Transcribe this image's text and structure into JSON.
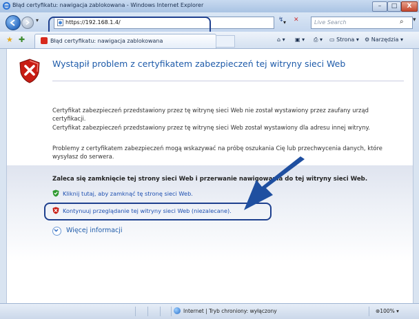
{
  "window": {
    "title": "Błąd certyfikatu: nawigacja zablokowana - Windows Internet Explorer",
    "controls": [
      "–",
      "□",
      "X"
    ]
  },
  "address_bar": {
    "url": "https://192.168.1.4/",
    "search_placeholder": "Live Search"
  },
  "tabs": [
    {
      "label": "Błąd certyfikatu: nawigacja zablokowana"
    }
  ],
  "toolbar": {
    "page_label": "Strona",
    "tools_label": "Narzędzia"
  },
  "content": {
    "heading": "Wystąpił problem z certyfikatem zabezpieczeń tej witryny sieci Web",
    "para1": "Certyfikat zabezpieczeń przedstawiony przez tę witrynę sieci Web nie został wystawiony przez zaufany urząd certyfikacji.",
    "para2": "Certyfikat zabezpieczeń przedstawiony przez tę witrynę sieci Web został wystawiony dla adresu innej witryny.",
    "para3": "Problemy z certyfikatem zabezpieczeń mogą wskazywać na próbę oszukania Cię lub przechwycenia danych, które wysyłasz do serwera.",
    "recommendation": "Zaleca się zamknięcie tej strony sieci Web i przerwanie nawigowania do tej witryny sieci Web.",
    "link_close": "Kliknij tutaj, aby zamknąć tę stronę sieci Web.",
    "link_continue": "Kontynuuj przeglądanie tej witryny sieci Web (niezalecane).",
    "more_info": "Więcej informacji"
  },
  "status_bar": {
    "zone": "Internet | Tryb chroniony: wyłączony",
    "zoom": "100%"
  },
  "colors": {
    "accent": "#1d5aa9",
    "highlight_outline": "#1d3f8e",
    "link": "#1d4fb0"
  }
}
